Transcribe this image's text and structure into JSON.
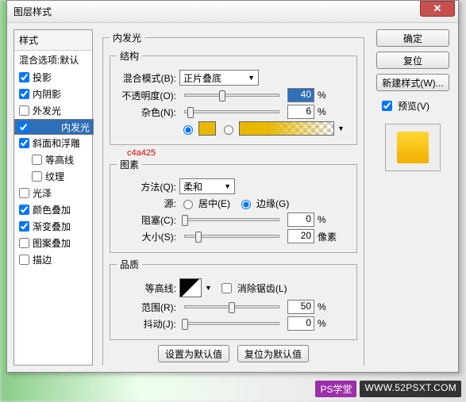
{
  "dialog": {
    "title": "图层样式"
  },
  "sidebar": {
    "header": "样式",
    "sub": "混合选项:默认",
    "items": [
      {
        "label": "投影",
        "checked": true
      },
      {
        "label": "内阴影",
        "checked": true
      },
      {
        "label": "外发光",
        "checked": false
      },
      {
        "label": "内发光",
        "checked": true,
        "selected": true
      },
      {
        "label": "斜面和浮雕",
        "checked": true
      },
      {
        "label": "等高线",
        "checked": false,
        "indent": true
      },
      {
        "label": "纹理",
        "checked": false,
        "indent": true
      },
      {
        "label": "光泽",
        "checked": false
      },
      {
        "label": "颜色叠加",
        "checked": true
      },
      {
        "label": "渐变叠加",
        "checked": true
      },
      {
        "label": "图案叠加",
        "checked": false
      },
      {
        "label": "描边",
        "checked": false
      }
    ]
  },
  "groups": {
    "main_title": "内发光",
    "struct": "结构",
    "elem": "图素",
    "qual": "品质"
  },
  "labels": {
    "blend": "混合模式(B):",
    "opacity": "不透明度(O):",
    "noise": "杂色(N):",
    "method": "方法(Q):",
    "source": "源:",
    "choke": "阻塞(C):",
    "size": "大小(S):",
    "contour": "等高线:",
    "antialias": "消除锯齿(L)",
    "range": "范围(R):",
    "jitter": "抖动(J):",
    "src_center": "居中(E)",
    "src_edge": "边缘(G)",
    "pct": "%",
    "px": "像素"
  },
  "values": {
    "blend": "正片叠底",
    "method": "柔和",
    "opacity": "40",
    "noise": "6",
    "choke": "0",
    "size": "20",
    "range": "50",
    "jitter": "0",
    "src_edge_checked": true,
    "grad_mode": "solid"
  },
  "slider_pos": {
    "opacity": 40,
    "noise": 6,
    "choke": 0,
    "size": 14,
    "range": 50,
    "jitter": 0
  },
  "annot": "c4a425",
  "buttons": {
    "set_def": "设置为默认值",
    "reset_def": "复位为默认值",
    "ok": "确定",
    "cancel": "复位",
    "newstyle": "新建样式(W)...",
    "preview": "预览(V)"
  },
  "footer": {
    "tag": "PS学堂",
    "url": "WWW.52PSXT.COM"
  }
}
